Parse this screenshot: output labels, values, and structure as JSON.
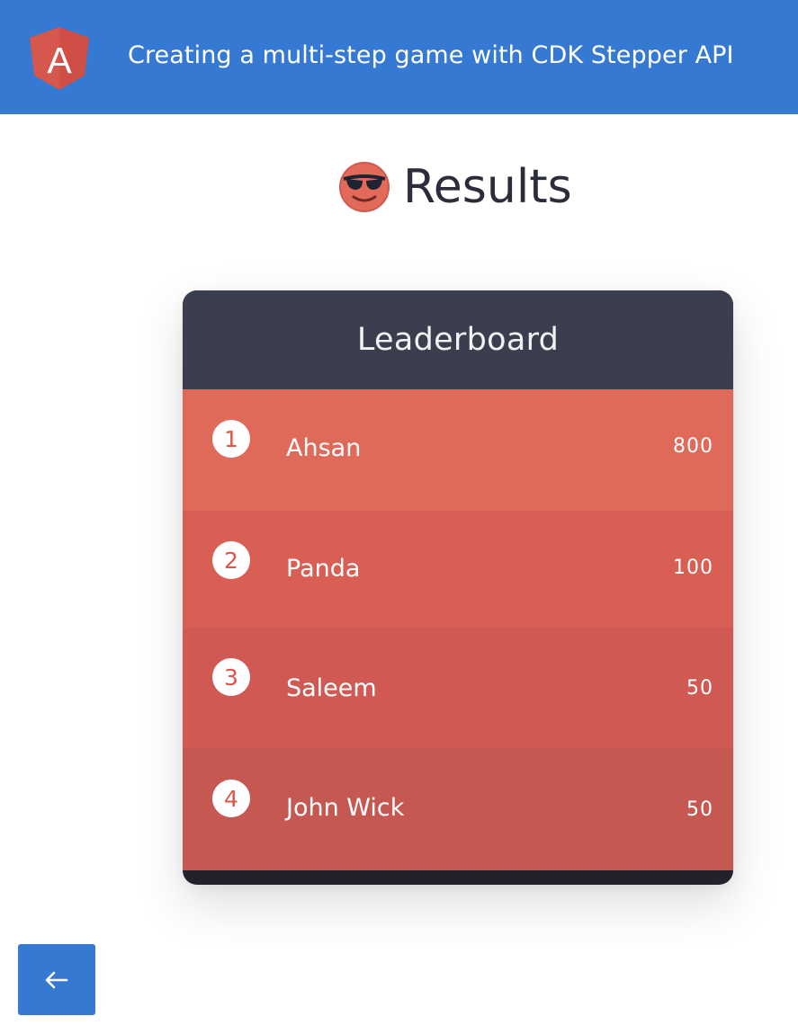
{
  "header": {
    "title": "Creating a multi-step game with CDK Stepper API",
    "logo_icon": "angular-logo",
    "logo_letter": "A",
    "colors": {
      "bar": "#3579d2",
      "logo": "#d6574e"
    }
  },
  "results": {
    "title": "Results",
    "icon": "smiling-face-with-sunglasses-icon"
  },
  "leaderboard": {
    "title": "Leaderboard",
    "rows": [
      {
        "rank": "1",
        "name": "Ahsan",
        "score": "800"
      },
      {
        "rank": "2",
        "name": "Panda",
        "score": "100"
      },
      {
        "rank": "3",
        "name": "Saleem",
        "score": "50"
      },
      {
        "rank": "4",
        "name": "John Wick",
        "score": "50"
      }
    ],
    "colors": {
      "header": "#3b3e4e",
      "rows": [
        "#e06a5a",
        "#d95f55",
        "#d05a53",
        "#c65852"
      ],
      "footer": "#21222c"
    }
  },
  "navigation": {
    "back_icon": "arrow-left-icon"
  }
}
